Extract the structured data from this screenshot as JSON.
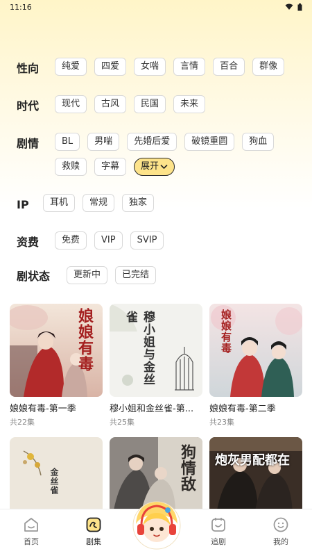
{
  "status": {
    "time": "11:16"
  },
  "filters": {
    "orientation": {
      "label": "性向",
      "options": [
        "纯爱",
        "四爱",
        "女喘",
        "言情",
        "百合",
        "群像"
      ]
    },
    "era": {
      "label": "时代",
      "options": [
        "现代",
        "古风",
        "民国",
        "未来"
      ]
    },
    "plot": {
      "label": "剧情",
      "options": [
        "BL",
        "男喘",
        "先婚后爱",
        "破镜重圆",
        "狗血",
        "救赎",
        "字幕"
      ],
      "expand_label": "展开"
    },
    "ip": {
      "label": "IP",
      "options": [
        "耳机",
        "常规",
        "独家"
      ]
    },
    "fee": {
      "label": "资费",
      "options": [
        "免费",
        "VIP",
        "SVIP"
      ]
    },
    "state": {
      "label": "剧状态",
      "options": [
        "更新中",
        "已完结"
      ]
    }
  },
  "dramas": [
    {
      "title": "娘娘有毒-第一季",
      "count": "共22集",
      "cover_text": "娘娘有毒"
    },
    {
      "title": "穆小姐和金丝雀-第...",
      "count": "共25集",
      "cover_text": "穆小姐与金丝雀"
    },
    {
      "title": "娘娘有毒-第二季",
      "count": "共23集",
      "cover_text": "娘娘有毒"
    },
    {
      "title": "",
      "count": "",
      "cover_text": "金丝雀"
    },
    {
      "title": "",
      "count": "",
      "cover_text": "狗情敌"
    },
    {
      "title": "",
      "count": "",
      "cover_text": "炮灰男配都在"
    }
  ],
  "tabbar": {
    "items": [
      {
        "label": "首页",
        "icon": "home-icon"
      },
      {
        "label": "剧集",
        "icon": "drama-icon"
      },
      {
        "label": "追剧",
        "icon": "follow-icon"
      },
      {
        "label": "我的",
        "icon": "profile-icon"
      }
    ]
  },
  "colors": {
    "accent": "#fde38a",
    "chip_border": "#d9d9d9",
    "header_bg": "#fff5c8"
  }
}
